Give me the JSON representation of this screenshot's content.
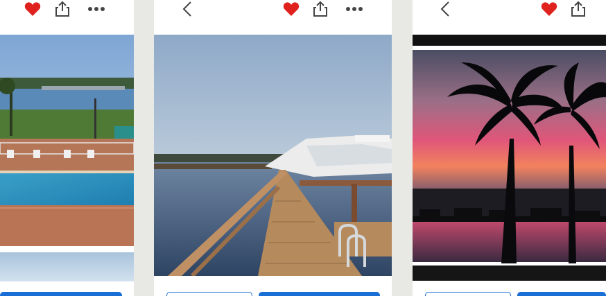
{
  "app": {
    "panels": [
      {
        "name": "left",
        "icons": [
          "heart-icon",
          "share-icon",
          "more-icon"
        ],
        "photos": [
          "pool-river-view",
          "sky-strip"
        ]
      },
      {
        "name": "center",
        "icons": [
          "back-chevron-icon",
          "heart-icon",
          "share-icon",
          "more-icon"
        ],
        "photos": [
          "dock-marina-view"
        ]
      },
      {
        "name": "right",
        "icons": [
          "back-chevron-icon",
          "heart-icon",
          "share-icon"
        ],
        "photos": [
          "palm-sunset-view"
        ]
      }
    ]
  },
  "colors": {
    "accent": "#1a6fd6",
    "favorite": "#e0221e",
    "background": "#e8e9e4",
    "icon": "#444444"
  }
}
